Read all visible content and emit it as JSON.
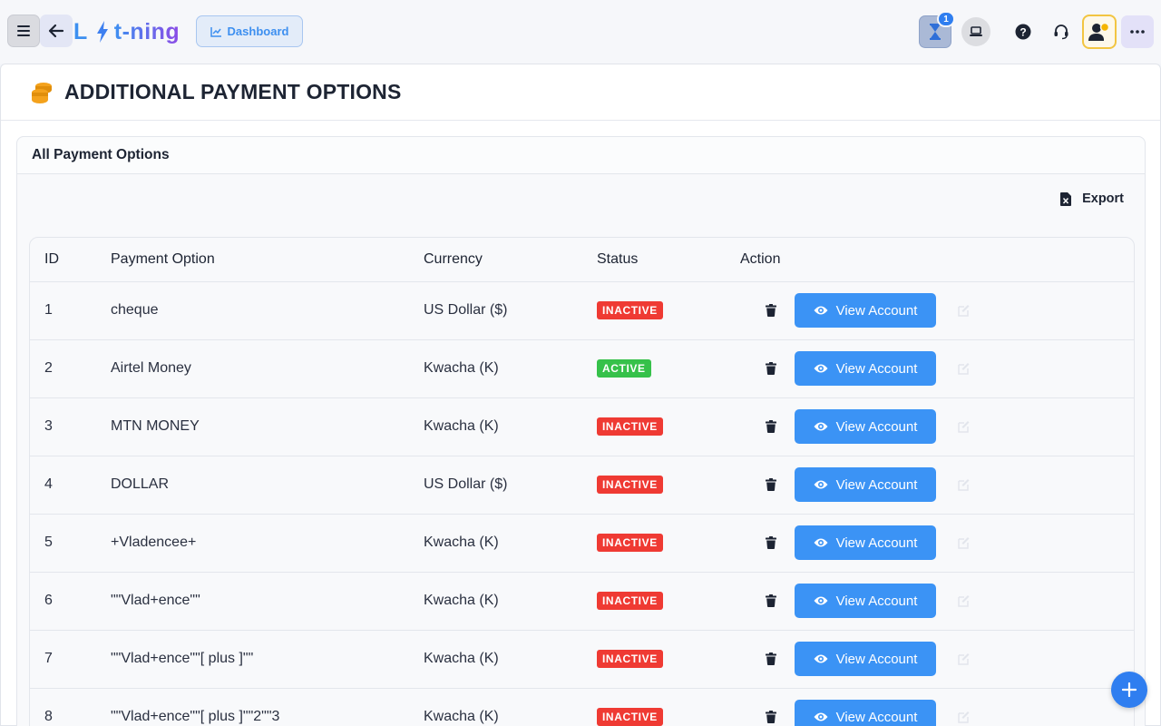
{
  "app": {
    "logo_left": "L",
    "logo_right": "t-ning",
    "dashboard_label": "Dashboard",
    "notification_count": "1",
    "icons": [
      "menu-icon",
      "back-arrow-icon",
      "bolt-icon",
      "chart-line-icon",
      "hourglass-icon",
      "laptop-icon",
      "help-icon",
      "headset-icon",
      "user-icon",
      "more-icon",
      "coins-icon",
      "excel-file-icon",
      "trash-icon",
      "eye-icon",
      "edit-icon",
      "plus-icon"
    ],
    "colors": {
      "accent": "#3b93f5",
      "inactive": "#ef3a33",
      "active": "#36c14a",
      "coins": "#f4a21c"
    }
  },
  "page": {
    "title": "ADDITIONAL PAYMENT OPTIONS",
    "card_title": "All Payment Options",
    "export_label": "Export"
  },
  "table": {
    "headers": {
      "id": "ID",
      "option": "Payment Option",
      "currency": "Currency",
      "status": "Status",
      "action": "Action"
    },
    "view_label": "View Account",
    "rows": [
      {
        "id": "1",
        "option": "cheque",
        "currency": "US Dollar ($)",
        "status": "INACTIVE"
      },
      {
        "id": "2",
        "option": "Airtel Money",
        "currency": "Kwacha (K)",
        "status": "ACTIVE"
      },
      {
        "id": "3",
        "option": "MTN MONEY",
        "currency": "Kwacha (K)",
        "status": "INACTIVE"
      },
      {
        "id": "4",
        "option": "DOLLAR",
        "currency": "US Dollar ($)",
        "status": "INACTIVE"
      },
      {
        "id": "5",
        "option": "+Vladencee+",
        "currency": "Kwacha (K)",
        "status": "INACTIVE"
      },
      {
        "id": "6",
        "option": "\"\"Vlad+ence\"\"",
        "currency": "Kwacha (K)",
        "status": "INACTIVE"
      },
      {
        "id": "7",
        "option": "\"\"Vlad+ence\"\"[ plus ]\"\"",
        "currency": "Kwacha (K)",
        "status": "INACTIVE"
      },
      {
        "id": "8",
        "option": "\"\"Vlad+ence\"\"[ plus ]\"\"2\"\"3",
        "currency": "Kwacha (K)",
        "status": "INACTIVE"
      }
    ]
  }
}
